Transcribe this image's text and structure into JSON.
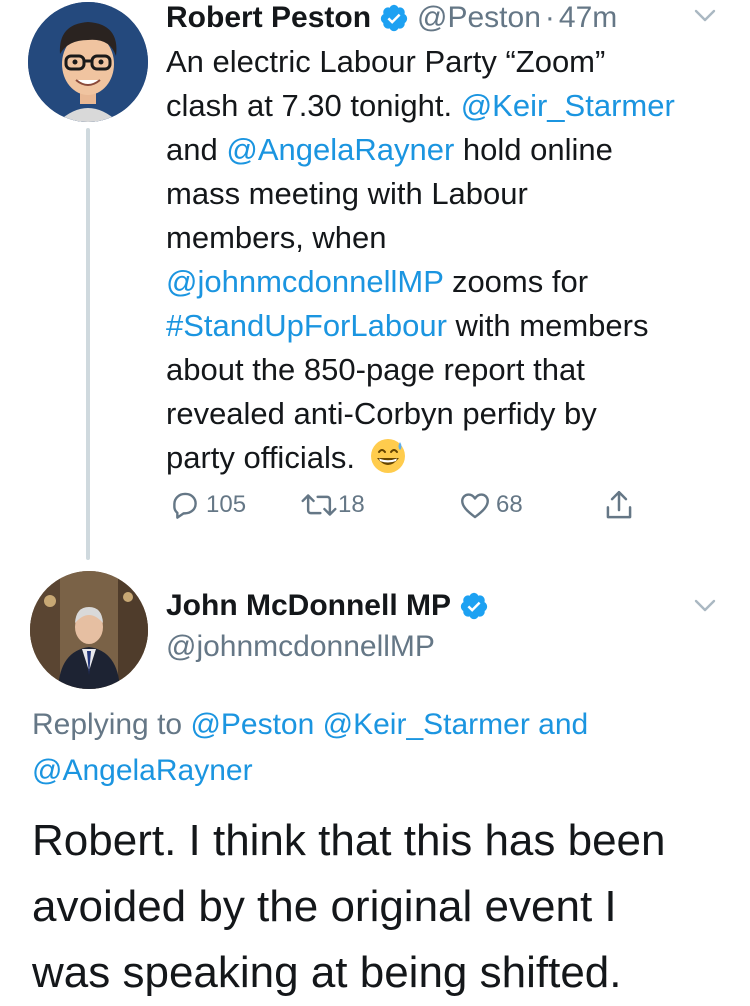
{
  "tweet1": {
    "display_name": "Robert Peston",
    "handle": "@Peston",
    "separator": "·",
    "time": "47m",
    "verified": true,
    "avatar_icon": "cartoon-avatar-icon",
    "text_lines": [
      [
        {
          "t": "An electric Labour Party “Zoom”",
          "link": false
        }
      ],
      [
        {
          "t": "clash at 7.30 tonight. ",
          "link": false
        },
        {
          "t": "@Keir_Starmer",
          "link": true
        }
      ],
      [
        {
          "t": "and ",
          "link": false
        },
        {
          "t": "@AngelaRayner",
          "link": true
        },
        {
          "t": " hold online",
          "link": false
        }
      ],
      [
        {
          "t": "mass meeting with Labour",
          "link": false
        }
      ],
      [
        {
          "t": "members, when",
          "link": false
        }
      ],
      [
        {
          "t": "@johnmcdonnellMP",
          "link": true
        },
        {
          "t": " zooms for",
          "link": false
        }
      ],
      [
        {
          "t": "#StandUpForLabour",
          "link": true
        },
        {
          "t": " with members",
          "link": false
        }
      ],
      [
        {
          "t": "about the 850-page report that",
          "link": false
        }
      ],
      [
        {
          "t": "revealed anti-Corbyn perfidy by",
          "link": false
        }
      ],
      [
        {
          "t": "party officials. ",
          "link": false
        }
      ]
    ],
    "emoji": "grinning-sweat-emoji",
    "actions": {
      "replies": "105",
      "retweets": "18",
      "likes": "68"
    }
  },
  "tweet2": {
    "display_name": "John McDonnell MP",
    "handle": "@johnmcdonnellMP",
    "verified": true,
    "avatar_icon": "photo-avatar-icon",
    "replying_prefix": "Replying to ",
    "replying_line1": [
      {
        "t": "@Peston",
        "link": true
      },
      {
        "t": " ",
        "link": false
      },
      {
        "t": "@Keir_Starmer",
        "link": true
      },
      {
        "t": " ",
        "link": false
      },
      {
        "t": "and",
        "link": true
      }
    ],
    "replying_line2": "@AngelaRayner",
    "text_lines": [
      "Robert. I think that this has been",
      "avoided by the original event I",
      "was speaking at being shifted."
    ]
  },
  "colors": {
    "link": "#1b95e0",
    "secondary": "#657786",
    "primary_text": "#14171a",
    "verified": "#1da1f2",
    "thread_line": "#cfd9de"
  }
}
